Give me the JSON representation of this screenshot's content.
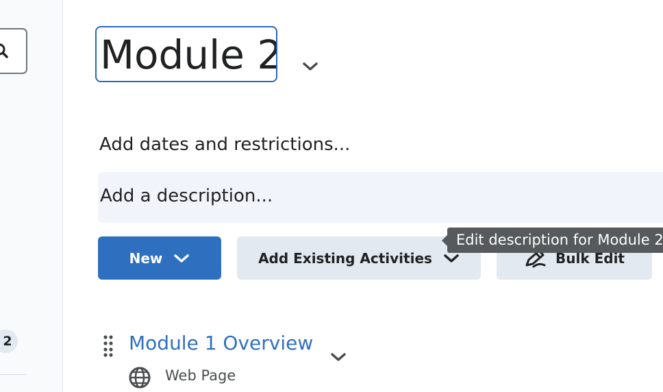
{
  "sidebar": {
    "search_icon": "search-icon",
    "count_badge": "2"
  },
  "module": {
    "title": "Module 2",
    "dates_link": "Add dates and restrictions...",
    "description_placeholder": "Add a description..."
  },
  "toolbar": {
    "new_label": "New",
    "add_existing_label": "Add Existing Activities",
    "bulk_edit_label": "Bulk Edit"
  },
  "tooltip": {
    "text": "Edit description for Module 2"
  },
  "items": [
    {
      "title": "Module 1 Overview",
      "type": "Web Page",
      "icon": "globe-icon"
    }
  ],
  "colors": {
    "accent": "#2f6fc0",
    "focus_border": "#2a64c4",
    "secondary_button": "#e3e9f1",
    "tooltip_bg": "#565a5c"
  }
}
